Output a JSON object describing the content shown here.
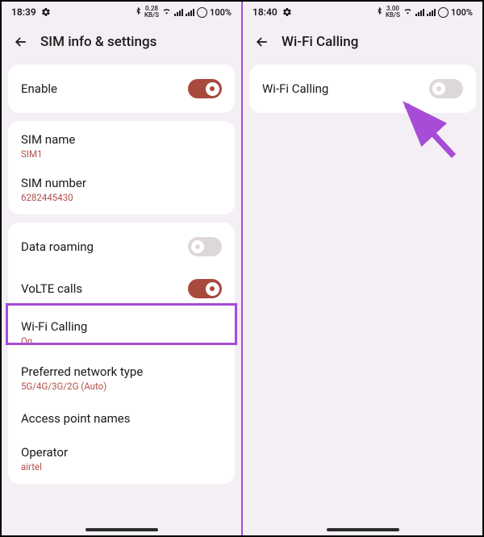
{
  "left": {
    "statusbar": {
      "time": "18:39",
      "rate": "0.28",
      "rate_unit": "KB/S",
      "battery": "100%"
    },
    "header": {
      "title": "SIM info & settings"
    },
    "enable": {
      "label": "Enable"
    },
    "sim_name": {
      "label": "SIM name",
      "value": "SIM1"
    },
    "sim_number": {
      "label": "SIM number",
      "value": "6282445430"
    },
    "data_roaming": {
      "label": "Data roaming"
    },
    "volte": {
      "label": "VoLTE calls"
    },
    "wifi_calling": {
      "label": "Wi-Fi Calling",
      "value": "On"
    },
    "pref_net": {
      "label": "Preferred network type",
      "value": "5G/4G/3G/2G (Auto)"
    },
    "apn": {
      "label": "Access point names"
    },
    "operator": {
      "label": "Operator",
      "value": "airtel"
    }
  },
  "right": {
    "statusbar": {
      "time": "18:40",
      "rate": "3.00",
      "rate_unit": "KB/S",
      "battery": "100%"
    },
    "header": {
      "title": "Wi-Fi Calling"
    },
    "wifi_calling": {
      "label": "Wi-Fi Calling"
    }
  }
}
